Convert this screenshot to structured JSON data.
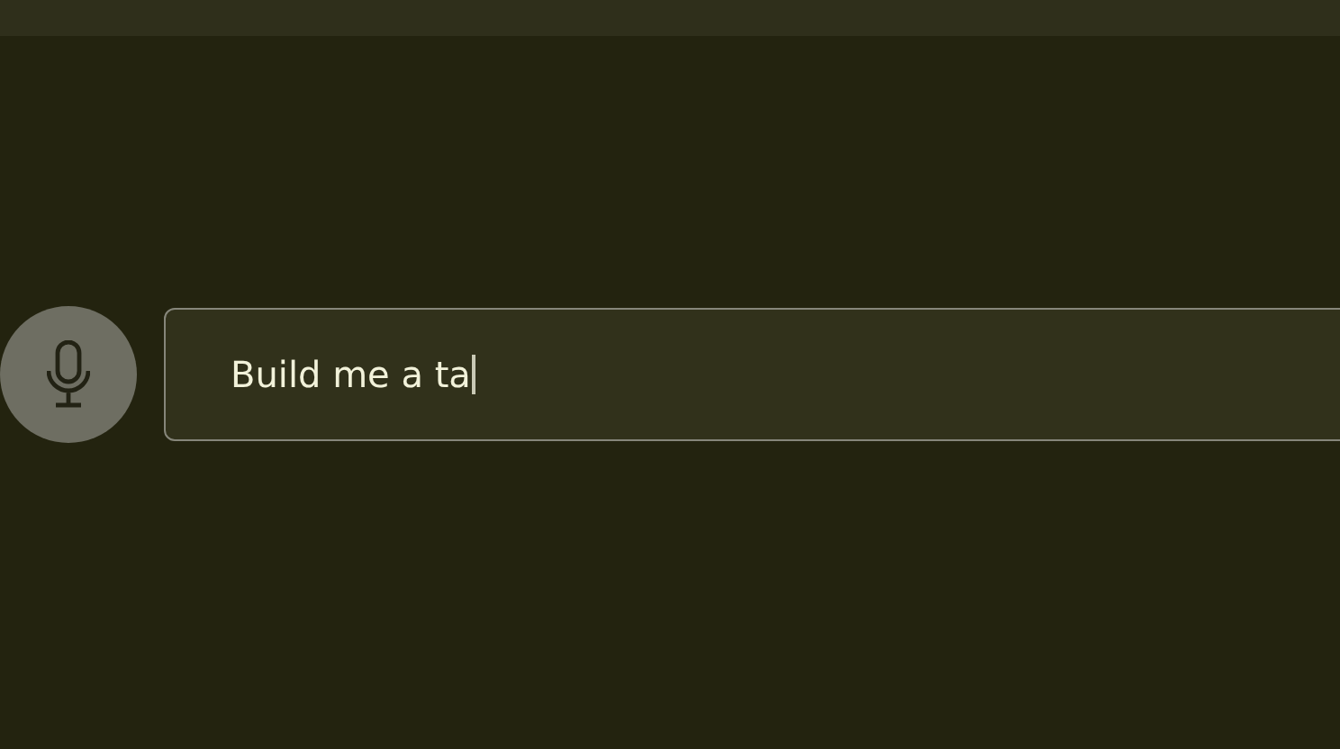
{
  "prompt": {
    "value": "Build me a ta",
    "focused": true
  }
}
